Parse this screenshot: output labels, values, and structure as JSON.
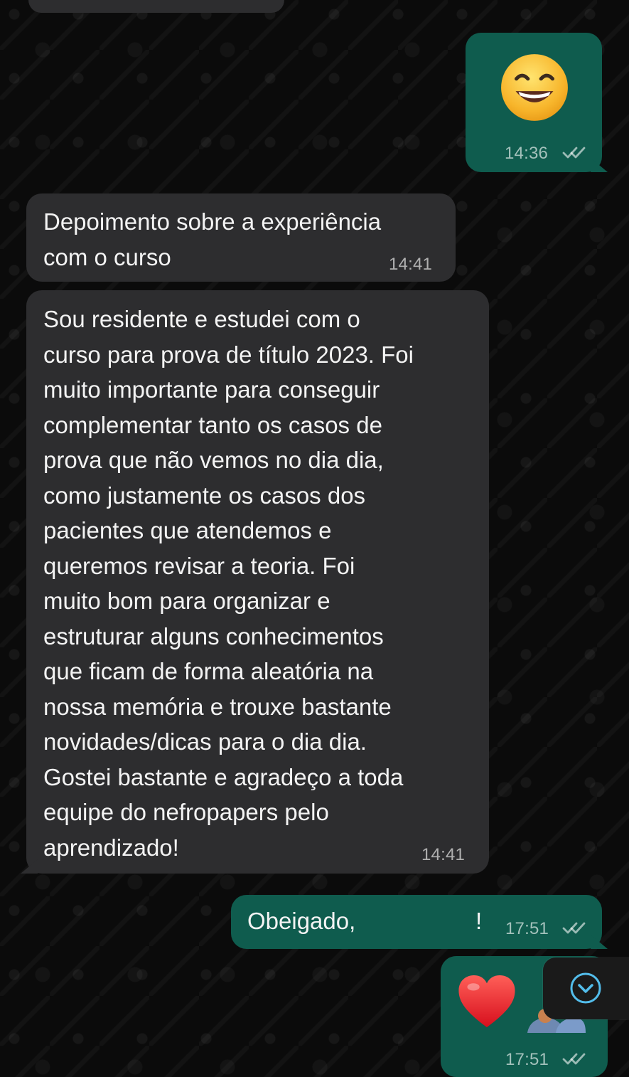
{
  "chat": {
    "messages": [
      {
        "id": "m1",
        "direction": "outgoing",
        "content_type": "emoji",
        "emoji": "grinning-face-with-smiling-eyes",
        "time": "14:36",
        "status": "read"
      },
      {
        "id": "m2",
        "direction": "incoming",
        "text": "Depoimento sobre a experiência\ncom o curso",
        "time": "14:41"
      },
      {
        "id": "m3",
        "direction": "incoming",
        "text": "Sou residente e estudei com o\ncurso para prova de título 2023. Foi\nmuito importante para conseguir\ncomplementar tanto os casos de\nprova que não vemos no dia dia,\ncomo justamente os casos dos\npacientes que atendemos e\nqueremos revisar a teoria. Foi\nmuito bom para organizar e\nestruturar alguns conhecimentos\nque ficam de forma aleatória na\nnossa memória e trouxe bastante\nnovidades/dicas para o dia dia.\nGostei bastante e agradeço a toda\nequipe do nefropapers pelo\naprendizado!",
        "time": "14:41"
      },
      {
        "id": "m4",
        "direction": "outgoing",
        "text": "Obeigado,",
        "suffix": "!",
        "time": "17:51",
        "status": "read"
      },
      {
        "id": "m5",
        "direction": "outgoing",
        "content_type": "emoji",
        "emoji": "red-heart",
        "time": "17:51",
        "status": "read"
      }
    ]
  },
  "controls": {
    "scroll_to_bottom_icon": "chevron-down-circle-icon"
  },
  "colors": {
    "background": "#0b0b0b",
    "incoming_bubble": "#2d2d2f",
    "outgoing_bubble": "#0f5c4e",
    "text": "#f3f3f3",
    "timestamp": "#a8a8a8",
    "scroll_button": "#1a1a1a",
    "scroll_icon": "#53bdeb"
  }
}
